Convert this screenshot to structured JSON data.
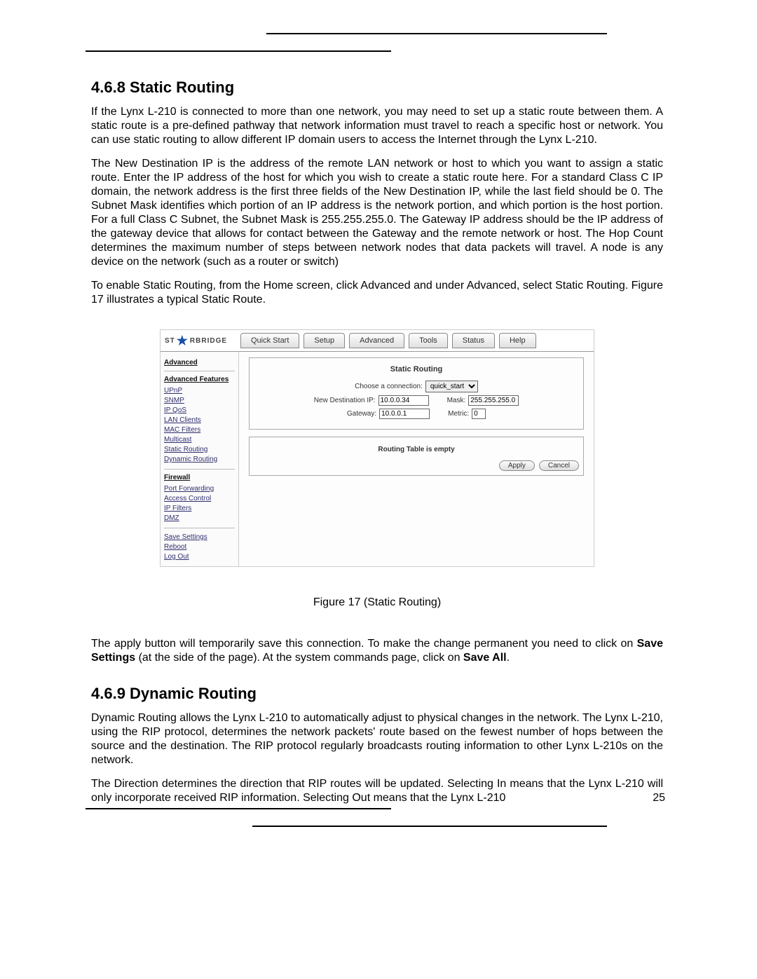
{
  "section1": {
    "heading": "4.6.8  Static Routing",
    "p1": "If the Lynx L-210 is connected to more than one network, you may need to set up a static route between them. A static route is a pre-defined pathway that network information must travel to reach a specific host or network. You can use static routing to allow different IP domain users to access the Internet through the Lynx L-210.",
    "p2": "The New Destination IP is the address of the remote LAN network or host to which you want to assign a static route. Enter the IP address of the host for which you wish to create a static route here. For a standard Class C IP domain, the network address is the first three fields of the New Destination IP, while the last field should be 0.  The Subnet Mask identifies which portion of an IP address is the network portion, and which portion is the host portion. For a full Class C Subnet, the Subnet Mask is 255.255.255.0.  The Gateway IP address should be the IP address of the gateway device that allows for contact between the Gateway and the remote network or host.  The Hop Count determines the maximum number of steps between network nodes that data packets will travel. A node is any device on the network (such as a router or switch)",
    "p3": "To enable Static Routing, from the Home screen, click Advanced and under Advanced, select Static Routing.   Figure 17 illustrates a typical Static Route."
  },
  "router": {
    "logo_left": "ST",
    "logo_right": "RBRIDGE",
    "tabs": [
      "Quick Start",
      "Setup",
      "Advanced",
      "Tools",
      "Status",
      "Help"
    ],
    "sidebar": {
      "hd1": "Advanced",
      "hd2": "Advanced Features",
      "items1": [
        "UPnP",
        "SNMP",
        "IP QoS",
        "LAN Clients",
        "MAC Filters",
        "Multicast",
        "Static Routing",
        "Dynamic Routing"
      ],
      "hd3": "Firewall",
      "items2": [
        "Port Forwarding",
        "Access Control",
        "IP Filters",
        "DMZ"
      ],
      "items3": [
        "Save Settings",
        "Reboot",
        "Log Out"
      ]
    },
    "card": {
      "title": "Static Routing",
      "choose_label": "Choose a connection:",
      "choose_value": "quick_start",
      "dest_label": "New Destination IP:",
      "dest_value": "10.0.0.34",
      "mask_label": "Mask:",
      "mask_value": "255.255.255.0",
      "gateway_label": "Gateway:",
      "gateway_value": "10.0.0.1",
      "metric_label": "Metric:",
      "metric_value": "0"
    },
    "card2": {
      "msg": "Routing Table is empty",
      "apply": "Apply",
      "cancel": "Cancel"
    }
  },
  "figure_caption": "Figure 17 (Static Routing)",
  "after_figure": {
    "p": "The apply button will temporarily save this connection. To make the change permanent you need to click on ",
    "bold1": "Save Settings",
    "mid": " (at the side of the page).  At the system commands page, click on ",
    "bold2": "Save All",
    "end": "."
  },
  "section2": {
    "heading": "4.6.9  Dynamic Routing",
    "p1": "Dynamic Routing allows the Lynx L-210 to automatically adjust to physical changes in the network. The Lynx L-210, using the RIP protocol, determines the network packets' route based on the fewest number of hops between the source and the destination. The RIP protocol regularly broadcasts routing information to other Lynx L-210s on the network.",
    "p2": "The Direction determines the direction that RIP routes will be updated.  Selecting In means that the Lynx L-210 will only incorporate received RIP information. Selecting Out means that the Lynx L-210"
  },
  "page_number": "25"
}
